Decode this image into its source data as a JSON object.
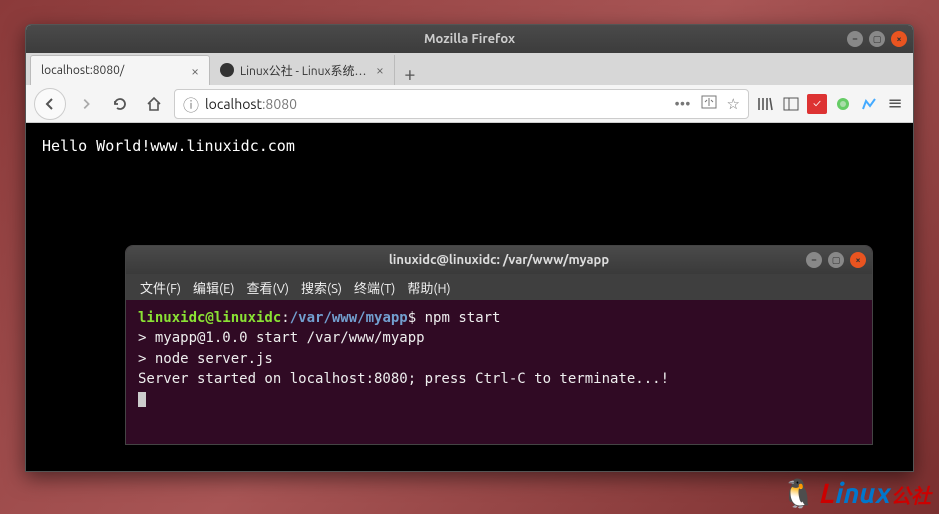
{
  "firefox": {
    "title": "Mozilla Firefox",
    "tabs": [
      {
        "label": "localhost:8080/",
        "active": true
      },
      {
        "label": "Linux公社 - Linux系统门户",
        "active": false
      }
    ],
    "url": {
      "prefix": "localhost",
      "suffix": ":8080"
    },
    "page_text": "Hello World!www.linuxidc.com"
  },
  "terminal": {
    "title": "linuxidc@linuxidc: /var/www/myapp",
    "menu": [
      "文件(F)",
      "编辑(E)",
      "查看(V)",
      "搜索(S)",
      "终端(T)",
      "帮助(H)"
    ],
    "prompt": {
      "user": "linuxidc@linuxidc",
      "sep": ":",
      "path": "/var/www/myapp",
      "dollar": "$"
    },
    "command": "npm start",
    "output": [
      "",
      "> myapp@1.0.0 start /var/www/myapp",
      "> node server.js",
      "",
      "Server started on localhost:8080; press Ctrl-C to terminate...!"
    ]
  },
  "watermark": {
    "text1": "L",
    "text2": "inux",
    "text3": "公社"
  }
}
